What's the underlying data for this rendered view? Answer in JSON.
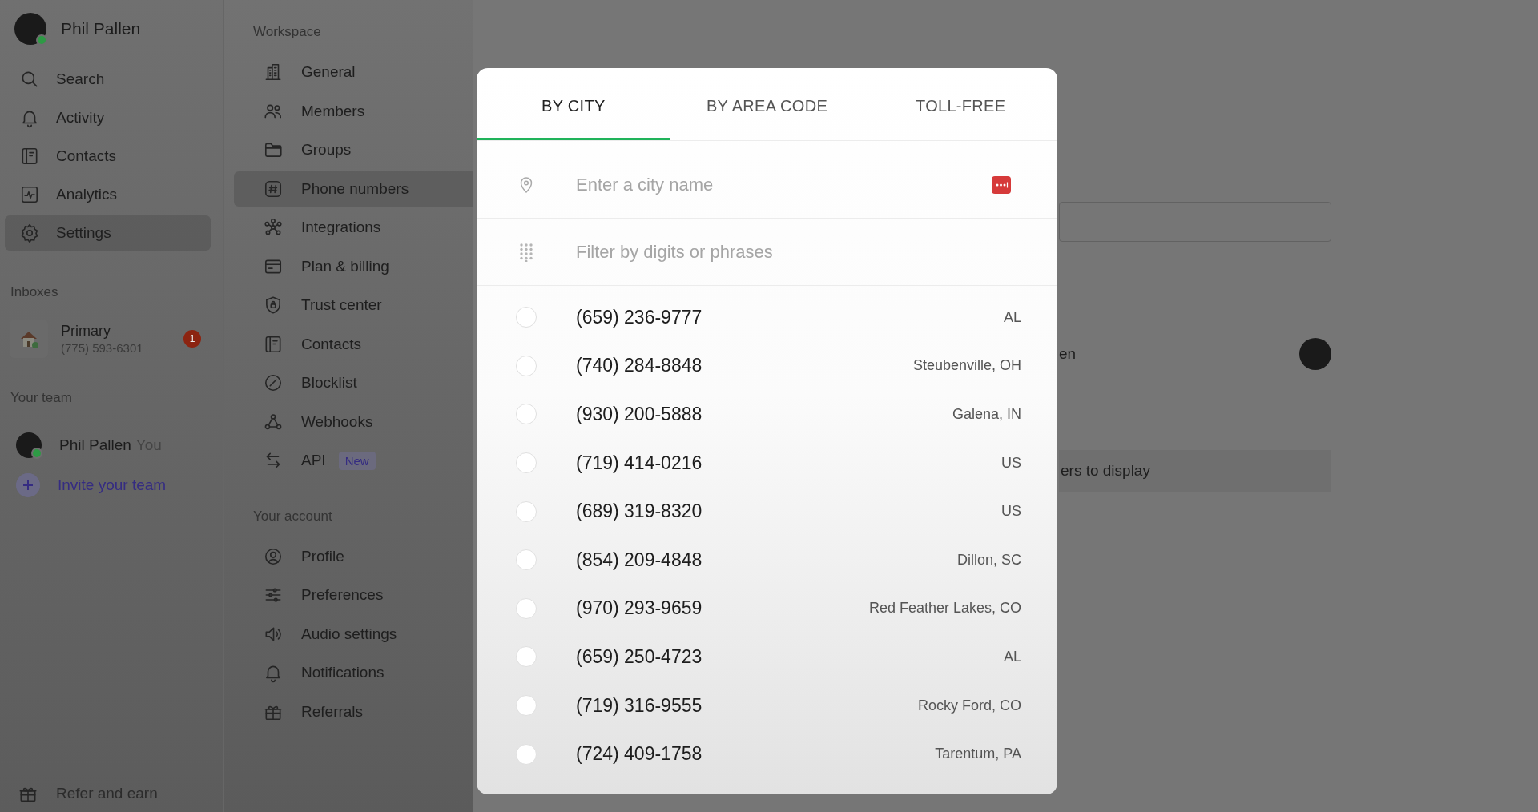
{
  "user": {
    "name": "Phil Pallen",
    "online": true
  },
  "nav": [
    {
      "label": "Search",
      "selected": false
    },
    {
      "label": "Activity",
      "selected": false
    },
    {
      "label": "Contacts",
      "selected": false
    },
    {
      "label": "Analytics",
      "selected": false
    },
    {
      "label": "Settings",
      "selected": true
    }
  ],
  "inboxes": {
    "heading": "Inboxes",
    "items": [
      {
        "name": "Primary",
        "number": "(775) 593-6301",
        "badge": "1"
      }
    ]
  },
  "team": {
    "heading": "Your team",
    "members": [
      {
        "name": "Phil Pallen",
        "tag": "You",
        "online": true
      }
    ],
    "invite": "Invite your team"
  },
  "refer": "Refer and earn",
  "settings_nav": [
    {
      "heading": "Workspace",
      "items": [
        {
          "label": "General",
          "selected": false
        },
        {
          "label": "Members",
          "selected": false
        },
        {
          "label": "Groups",
          "selected": false
        },
        {
          "label": "Phone numbers",
          "selected": true
        },
        {
          "label": "Integrations",
          "selected": false
        },
        {
          "label": "Plan & billing",
          "selected": false
        },
        {
          "label": "Trust center",
          "selected": false
        },
        {
          "label": "Contacts",
          "selected": false
        },
        {
          "label": "Blocklist",
          "selected": false
        },
        {
          "label": "Webhooks",
          "selected": false
        },
        {
          "label": "API",
          "selected": false,
          "badge": "New"
        }
      ]
    },
    {
      "heading": "Your account",
      "items": [
        {
          "label": "Profile",
          "selected": false
        },
        {
          "label": "Preferences",
          "selected": false
        },
        {
          "label": "Audio settings",
          "selected": false
        },
        {
          "label": "Notifications",
          "selected": false
        },
        {
          "label": "Referrals",
          "selected": false
        }
      ]
    }
  ],
  "background": {
    "member_text": "en",
    "empty_text": "ers to display"
  },
  "modal": {
    "tabs": [
      {
        "label": "BY CITY",
        "selected": true
      },
      {
        "label": "BY AREA CODE",
        "selected": false
      },
      {
        "label": "TOLL-FREE",
        "selected": false
      }
    ],
    "city_field": {
      "placeholder": "Enter a city name"
    },
    "filter_field": {
      "placeholder": "Filter by digits or phrases"
    },
    "numbers": [
      {
        "number": "(659) 236-9777",
        "location": "AL",
        "selected": false
      },
      {
        "number": "(740) 284-8848",
        "location": "Steubenville, OH",
        "selected": false
      },
      {
        "number": "(930) 200-5888",
        "location": "Galena, IN",
        "selected": false
      },
      {
        "number": "(719) 414-0216",
        "location": "US",
        "selected": false
      },
      {
        "number": "(689) 319-8320",
        "location": "US",
        "selected": false
      },
      {
        "number": "(854) 209-4848",
        "location": "Dillon, SC",
        "selected": false
      },
      {
        "number": "(970) 293-9659",
        "location": "Red Feather Lakes, CO",
        "selected": false
      },
      {
        "number": "(659) 250-4723",
        "location": "AL",
        "selected": false
      },
      {
        "number": "(719) 316-9555",
        "location": "Rocky Ford, CO",
        "selected": false
      },
      {
        "number": "(724) 409-1758",
        "location": "Tarentum, PA",
        "selected": false
      }
    ]
  }
}
